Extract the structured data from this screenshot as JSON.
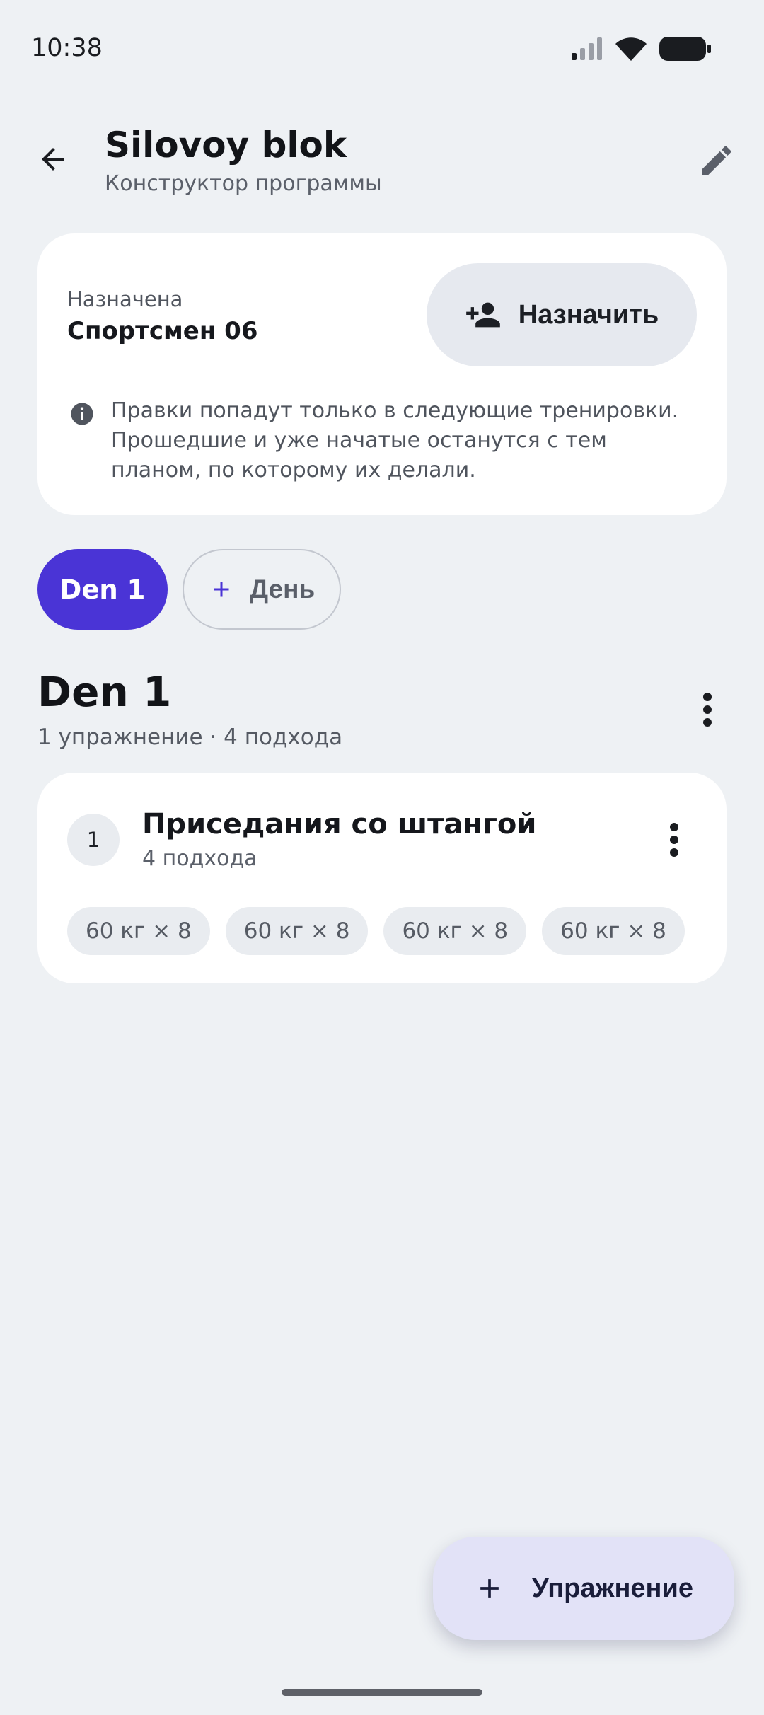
{
  "status_bar": {
    "time": "10:38",
    "icons": [
      "signal-icon",
      "wifi-icon",
      "battery-icon"
    ]
  },
  "header": {
    "title": "Silovoy blok",
    "subtitle": "Конструктор программы",
    "back_icon": "arrow-left-icon",
    "edit_icon": "pencil-icon"
  },
  "assignment": {
    "label": "Назначена",
    "athlete": "Спортсмен 06",
    "assign_button_label": "Назначить",
    "assign_icon": "person-add-icon",
    "info_text": "Правки попадут только в следующие тренировки. Прошедшие и уже начатые останутся с тем планом, по которому их делали."
  },
  "day_tabs": {
    "items": [
      {
        "label": "Den 1",
        "active": true
      }
    ],
    "add_label": "День"
  },
  "day": {
    "title": "Den 1",
    "summary": "1 упражнение · 4 подхода"
  },
  "exercises": [
    {
      "number": "1",
      "name": "Приседания со штангой",
      "sets_text": "4 подхода",
      "sets": [
        "60 кг × 8",
        "60 кг × 8",
        "60 кг × 8",
        "60 кг × 8"
      ]
    }
  ],
  "fab": {
    "label": "Упражнение",
    "icon": "plus-icon"
  },
  "colors": {
    "background": "#eef1f4",
    "accent": "#4a34d6",
    "fab_background": "#e2e2f7",
    "card": "#ffffff"
  }
}
